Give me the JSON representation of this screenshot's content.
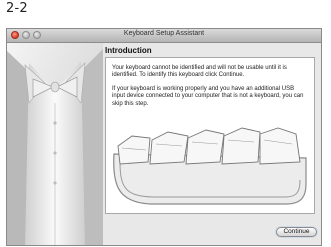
{
  "figure_label": "2-2",
  "window": {
    "title": "Keyboard Setup Assistant"
  },
  "content": {
    "heading": "Introduction",
    "paragraph_1": "Your keyboard cannot be identified and will not be usable until it is identified. To identify this keyboard click Continue.",
    "paragraph_2": "If your keyboard is working properly and you have an additional USB input device connected to your computer that is not a keyboard, you can skip this step."
  },
  "buttons": {
    "continue_label": "Continue"
  },
  "icons": {
    "sidebar_art": "tuxedo-bowtie-icon",
    "keyboard": "keyboard-icon"
  }
}
